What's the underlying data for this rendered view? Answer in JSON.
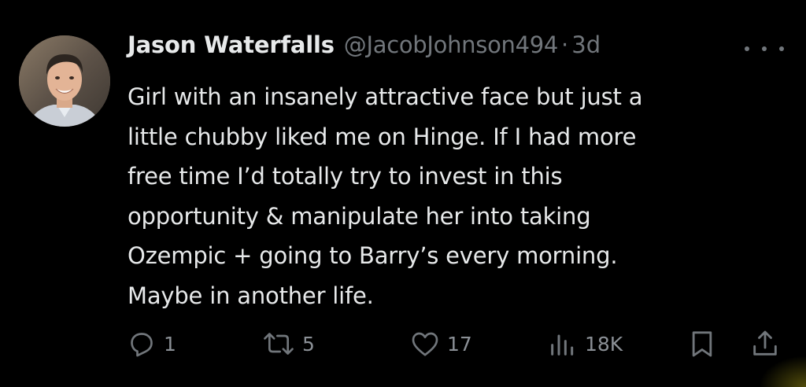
{
  "tweet": {
    "display_name": "Jason Waterfalls",
    "handle": "@JacobJohnson494",
    "separator": "·",
    "time": "3d",
    "text": "Girl with an insanely attractive face but just a\nlittle chubby liked me on Hinge. If I had more\nfree time I’d totally try to invest in this\nopportunity & manipulate her into taking\nOzempic + going to Barry’s every morning.\nMaybe in another life."
  },
  "actions": {
    "replies": "1",
    "reposts": "5",
    "likes": "17",
    "views": "18K"
  },
  "icons": {
    "more": "more-horizontal-icon",
    "reply": "reply-icon",
    "repost": "repost-icon",
    "like": "heart-icon",
    "views": "views-chart-icon",
    "bookmark": "bookmark-icon",
    "share": "share-icon"
  },
  "colors": {
    "background": "#000000",
    "text_primary": "#e7e9ea",
    "text_secondary": "#71767b"
  }
}
